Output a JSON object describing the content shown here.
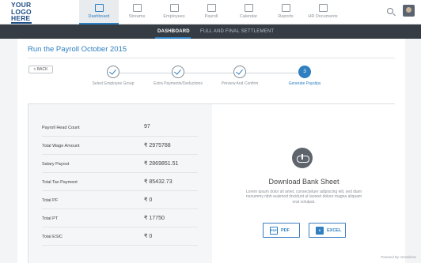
{
  "logo": {
    "text": "YOUR\nLOGO\nHERE"
  },
  "nav": {
    "items": [
      {
        "label": "Dashboard",
        "icon": "dashboard-icon",
        "active": true
      },
      {
        "label": "Streams",
        "icon": "streams-icon",
        "active": false
      },
      {
        "label": "Employees",
        "icon": "employees-icon",
        "active": false
      },
      {
        "label": "Payroll",
        "icon": "payroll-icon",
        "active": false
      },
      {
        "label": "Calendar",
        "icon": "calendar-icon",
        "active": false
      },
      {
        "label": "Reports",
        "icon": "reports-icon",
        "active": false
      },
      {
        "label": "HR Documents",
        "icon": "hr-documents-icon",
        "active": false
      }
    ]
  },
  "subnav": {
    "items": [
      {
        "label": "DASHBOARD",
        "active": true
      },
      {
        "label": "FULL AND FINAL SETTLEMENT",
        "active": false
      }
    ]
  },
  "page": {
    "title": "Run the Payroll October 2015",
    "back_label": "< BACK"
  },
  "steps": [
    {
      "label": "Select Employee Group",
      "state": "done",
      "number": ""
    },
    {
      "label": "Extra Payments/Deductions",
      "state": "done",
      "number": ""
    },
    {
      "label": "Preview And Confirm",
      "state": "done",
      "number": ""
    },
    {
      "label": "Generate Payslips",
      "state": "current",
      "number": "3"
    }
  ],
  "summary": [
    {
      "label": "Payroll Head Count",
      "value": "97"
    },
    {
      "label": "Total Wage Amount",
      "value": "₹ 2975788"
    },
    {
      "label": "Salary Payout",
      "value": "₹ 2869851.51"
    },
    {
      "label": "Total Tax Payment",
      "value": "₹ 85432.73"
    },
    {
      "label": "Total PF",
      "value": "₹ 0"
    },
    {
      "label": "Total PT",
      "value": "₹ 17750"
    },
    {
      "label": "Total ESIC",
      "value": "₹ 0"
    }
  ],
  "download": {
    "title": "Download Bank Sheet",
    "description": "Lorem ipsum dolor sit amet, consectetuer adipiscing elit, sed diam nonummy nibh euismod tincidunt ut laoreet dolore magna aliquam erat volutpat.",
    "pdf_label": "PDF",
    "pdf_icon_text": "PDF",
    "excel_label": "EXCEL",
    "excel_icon_text": "X"
  },
  "footer": {
    "text": "Powered By: Darwinbox"
  },
  "colors": {
    "accent": "#2f7fc1",
    "subnav_bg": "#353c44",
    "logo": "#1f4f86"
  }
}
